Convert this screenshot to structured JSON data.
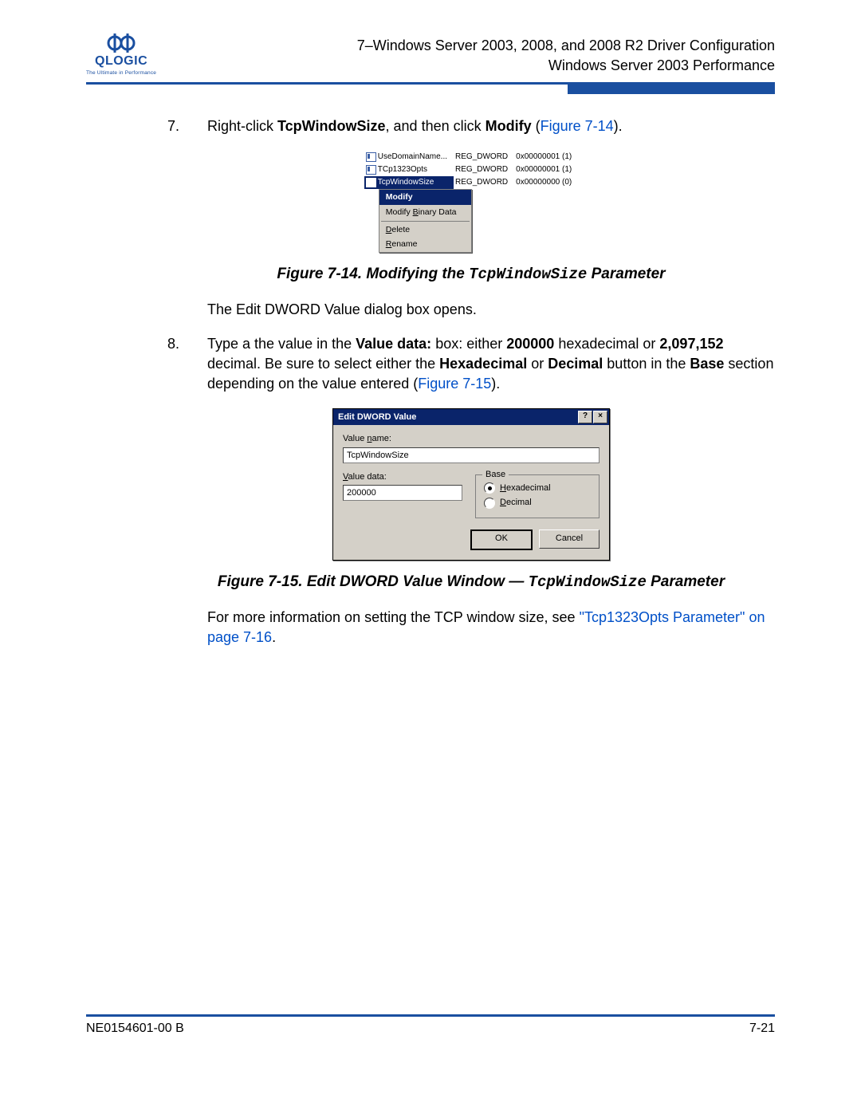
{
  "header": {
    "logo_text": "QLOGIC",
    "tagline": "The Ultimate in Performance",
    "line1": "7–Windows Server 2003, 2008, and 2008 R2 Driver Configuration",
    "line2": "Windows Server 2003 Performance"
  },
  "steps": {
    "s7": {
      "num": "7.",
      "pre": "Right-click ",
      "b1": "TcpWindowSize",
      "mid": ", and then click ",
      "b2": "Modify",
      "post": " (",
      "link": "Figure 7-14",
      "end": ")."
    },
    "fig14_caption_pre": "Figure 7-14.  Modifying the ",
    "fig14_caption_code": "TcpWindowSize",
    "fig14_caption_post": " Parameter",
    "after7": "The Edit DWORD Value dialog box opens.",
    "s8": {
      "num": "8.",
      "t1": "Type a the value in the ",
      "b1": "Value data:",
      "t2": " box: either ",
      "b2": "200000",
      "t3": " hexadecimal or ",
      "b3": "2,097,152",
      "t4": " decimal. Be sure to select either the ",
      "b4": "Hexadecimal",
      "t5": " or ",
      "b5": "Decimal",
      "t6": " button in the ",
      "b6": "Base",
      "t7": " section depending on the value entered (",
      "link": "Figure 7-15",
      "end": ")."
    },
    "fig15_caption_pre": "Figure 7-15.  Edit DWORD Value Window — ",
    "fig15_caption_code": "TcpWindowSize",
    "fig15_caption_post": " Parameter",
    "more_pre": "For more information on setting the TCP window size, see ",
    "more_link": "\"Tcp1323Opts Parameter\" on page 7-16",
    "more_end": "."
  },
  "fig14": {
    "rows": [
      {
        "name": "UseDomainName...",
        "type": "REG_DWORD",
        "val": "0x00000001 (1)"
      },
      {
        "name": "TCp1323Opts",
        "type": "REG_DWORD",
        "val": "0x00000001 (1)"
      },
      {
        "name": "TcpWindowSize",
        "type": "REG_DWORD",
        "val": "0x00000000 (0)"
      }
    ],
    "menu": {
      "modify": "Modify",
      "modify_binary": "Modify Binary Data",
      "delete": "Delete",
      "rename": "Rename"
    }
  },
  "fig15": {
    "title": "Edit DWORD Value",
    "help_btn": "?",
    "close_btn": "×",
    "value_name_label": "Value name:",
    "value_name": "TcpWindowSize",
    "value_data_label": "Value data:",
    "value_data": "200000",
    "base_label": "Base",
    "hex_label": "Hexadecimal",
    "dec_label": "Decimal",
    "ok": "OK",
    "cancel": "Cancel"
  },
  "footer": {
    "left": "NE0154601-00  B",
    "right": "7-21"
  }
}
